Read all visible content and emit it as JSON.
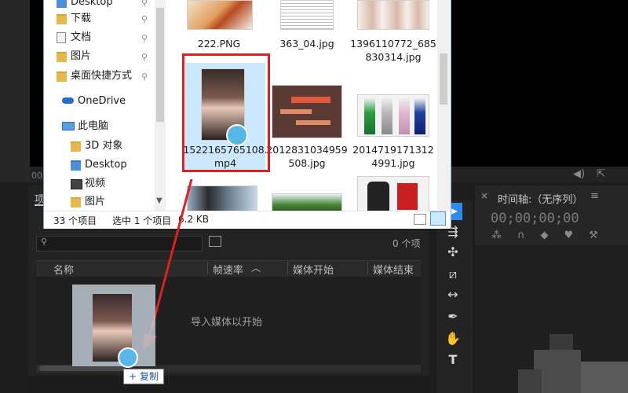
{
  "nav": {
    "items": [
      {
        "label": "Desktop",
        "icon": "folder-desktop-icon",
        "pinned": true
      },
      {
        "label": "下载",
        "icon": "download-folder-icon",
        "pinned": true
      },
      {
        "label": "文档",
        "icon": "document-folder-icon",
        "pinned": true
      },
      {
        "label": "图片",
        "icon": "picture-folder-icon",
        "pinned": true
      },
      {
        "label": "桌面快捷方式",
        "icon": "folder-icon",
        "pinned": true
      },
      {
        "label": "OneDrive",
        "icon": "cloud-icon"
      },
      {
        "label": "此电脑",
        "icon": "computer-icon"
      },
      {
        "label": "3D 对象",
        "icon": "3d-objects-icon"
      },
      {
        "label": "Desktop",
        "icon": "folder-desktop-icon"
      },
      {
        "label": "视频",
        "icon": "video-folder-icon"
      },
      {
        "label": "图片",
        "icon": "picture-folder-icon"
      }
    ]
  },
  "files": {
    "row1": [
      "222.PNG",
      "363_04.jpg",
      "1396110772_685830314.jpg"
    ],
    "row2": [
      "1522165765108.mp4",
      "2012831034959508.jpg",
      "20147191713124991.jpg"
    ]
  },
  "status": {
    "count": "33 个项目",
    "selected": "选中 1 个项目",
    "size": "6.2 KB"
  },
  "project": {
    "tab": "项",
    "item_count": "0 个项",
    "columns": [
      "名称",
      "帧速率",
      "媒体开始",
      "媒体结束"
    ],
    "import_hint": "导入媒体以开始"
  },
  "timeline": {
    "title": "时间轴:（无序列）",
    "timecode": "00;00;00;00"
  },
  "monitor": {
    "timecode": "00"
  },
  "drag": {
    "tooltip": "复制",
    "tooltip_plus": "+"
  },
  "colors": {
    "selection": "#cce8ff",
    "highlight_box": "#e02020",
    "arrow": "#e02020",
    "tool_active": "#2d8ceb"
  }
}
